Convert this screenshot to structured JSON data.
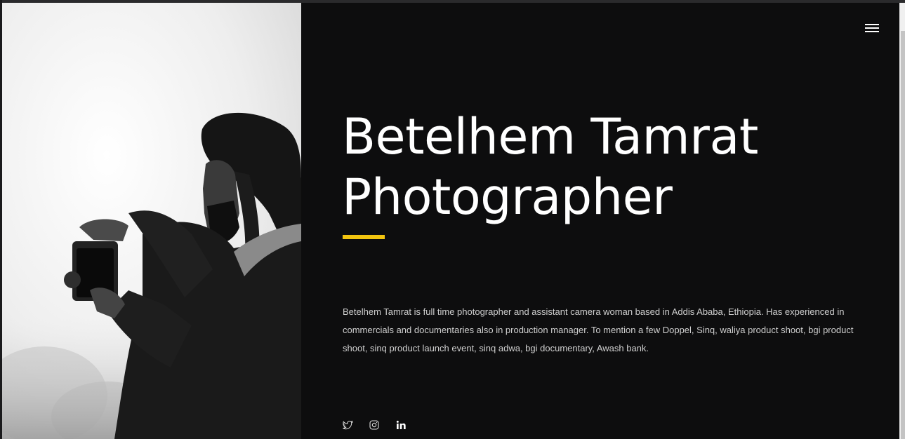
{
  "header": {
    "menu_icon": "hamburger-menu-icon"
  },
  "hero": {
    "name": "Betelhem Tamrat",
    "role": "Photographer",
    "accent_color": "#f2c40f"
  },
  "bio": {
    "text": "Betelhem Tamrat is full time photographer and assistant camera woman based in Addis Ababa, Ethiopia. Has experienced in commercials and documentaries also in production manager. To mention a few Doppel, Sinq, waliya product shoot, bgi product shoot, sinq product launch event, sinq adwa, bgi documentary, Awash bank."
  },
  "socials": [
    {
      "icon": "twitter-icon"
    },
    {
      "icon": "instagram-icon"
    },
    {
      "icon": "linkedin-icon"
    }
  ],
  "colors": {
    "background": "#0d0d0e",
    "text": "#ffffff",
    "body_text": "#cfcfcf",
    "accent": "#f2c40f"
  }
}
